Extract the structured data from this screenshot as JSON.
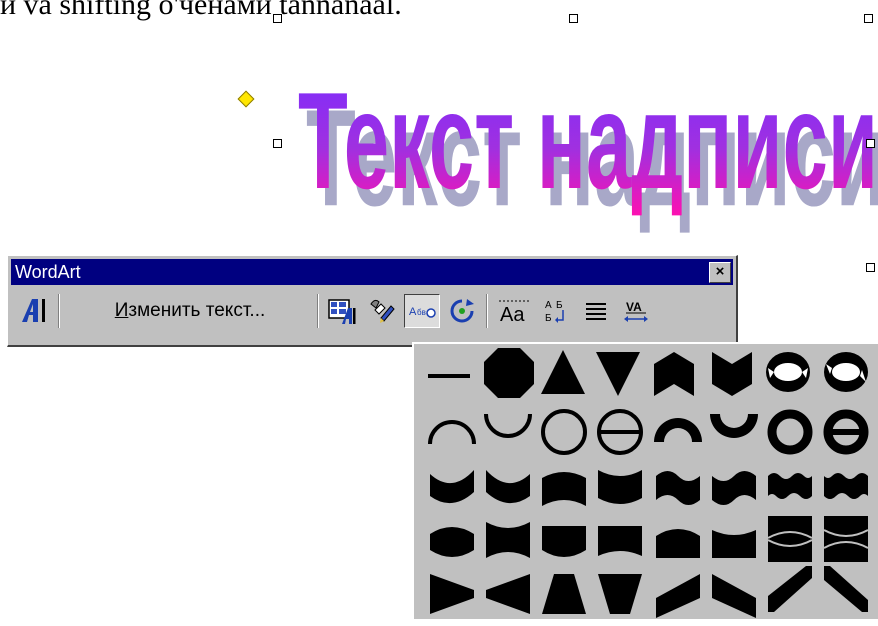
{
  "document": {
    "top_text": "и va shifting o'ченами tannanaal.",
    "wordart_text": "Текст надписи"
  },
  "toolbar": {
    "title": "WordArt",
    "close_label": "×",
    "edit_text_first": "И",
    "edit_text_rest": "зменить текст...",
    "buttons": [
      {
        "name": "insert-wordart-icon"
      },
      {
        "name": "wordart-gallery-icon"
      },
      {
        "name": "format-wordart-icon"
      },
      {
        "name": "wordart-shape-icon",
        "pressed": true
      },
      {
        "name": "free-rotate-icon"
      },
      {
        "name": "same-letter-heights-icon"
      },
      {
        "name": "vertical-text-icon"
      },
      {
        "name": "alignment-icon"
      },
      {
        "name": "character-spacing-icon"
      }
    ]
  },
  "shape_palette": {
    "rows": [
      [
        "plain-text",
        "stop",
        "triangle-up",
        "triangle-down",
        "chevron-up",
        "chevron-down",
        "ring-inside",
        "ring-outside"
      ],
      [
        "arch-up-curve",
        "arch-down-curve",
        "circle-curve",
        "button-curve",
        "arch-up-pour",
        "arch-down-pour",
        "circle-pour",
        "button-pour"
      ],
      [
        "curve-up",
        "curve-down",
        "can-up",
        "can-down",
        "wave-1",
        "wave-2",
        "double-wave-1",
        "double-wave-2"
      ],
      [
        "inflate",
        "deflate",
        "inflate-bottom",
        "deflate-bottom",
        "inflate-top",
        "deflate-top",
        "deflate-inflate",
        "deflate-inflate-deflate"
      ],
      [
        "fade-right",
        "fade-left",
        "fade-up",
        "fade-down",
        "slant-up",
        "slant-down",
        "cascade-up",
        "cascade-down"
      ]
    ]
  }
}
